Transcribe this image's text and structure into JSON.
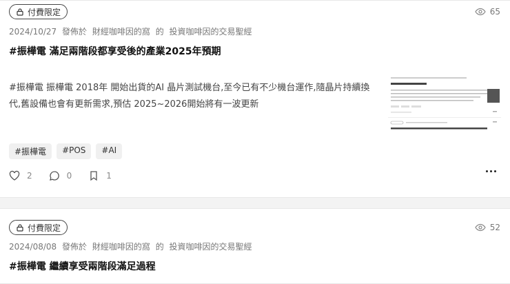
{
  "posts": [
    {
      "badge": "付費限定",
      "views": "65",
      "date": "2024/10/27",
      "published_at": "發佈於",
      "author": "財經咖啡因的窩",
      "of": "的",
      "column": "投資咖啡因的交易聖經",
      "title": "#振樺電 滿足兩階段都享受後的產業2025年預期",
      "excerpt": "#振樺電 振樺電 2018年 開始出貨的AI 晶片測試機台,至今已有不少機台運作,隨晶片持續換代,舊設備也會有更新需求,預估 2025~2026開始將有一波更新",
      "tags": [
        "#振樺電",
        "#POS",
        "#AI"
      ],
      "likes": "2",
      "comments": "0",
      "saves": "1"
    },
    {
      "badge": "付費限定",
      "views": "52",
      "date": "2024/08/08",
      "published_at": "發佈於",
      "author": "財經咖啡因的窩",
      "of": "的",
      "column": "投資咖啡因的交易聖經",
      "title": "#振樺電 繼續享受兩階段滿足過程"
    }
  ],
  "icons": {
    "lock": "lock-icon",
    "eye": "eye-icon",
    "heart": "heart-icon",
    "comment": "comment-icon",
    "bookmark": "bookmark-icon",
    "more": "more-icon"
  }
}
